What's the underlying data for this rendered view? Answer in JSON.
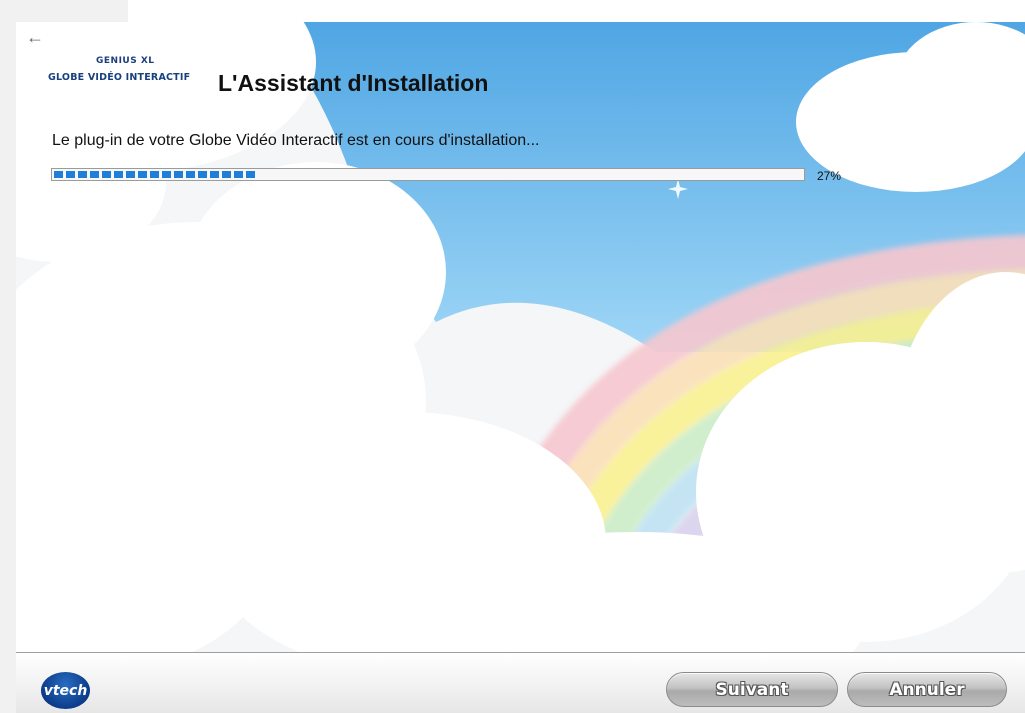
{
  "window": {
    "back_icon": "back-arrow-icon",
    "logo": {
      "top_text": "GENIUS XL",
      "bottom_text": "GLOBE VIDÉO INTERACTIF"
    },
    "title": "L'Assistant d'Installation",
    "status_text": "Le plug-in de votre Globe Vidéo Interactif est en cours d'installation...",
    "progress": {
      "percent_value": 27,
      "percent_label": "27%"
    }
  },
  "footer": {
    "brand_logo": "vtech",
    "next_label": "Suivant",
    "cancel_label": "Annuler"
  },
  "colors": {
    "sky": "#67b8ea",
    "progress_fill": "#1f7ed8",
    "brand": "#0b3c8a",
    "button": "#b8b8b8"
  }
}
